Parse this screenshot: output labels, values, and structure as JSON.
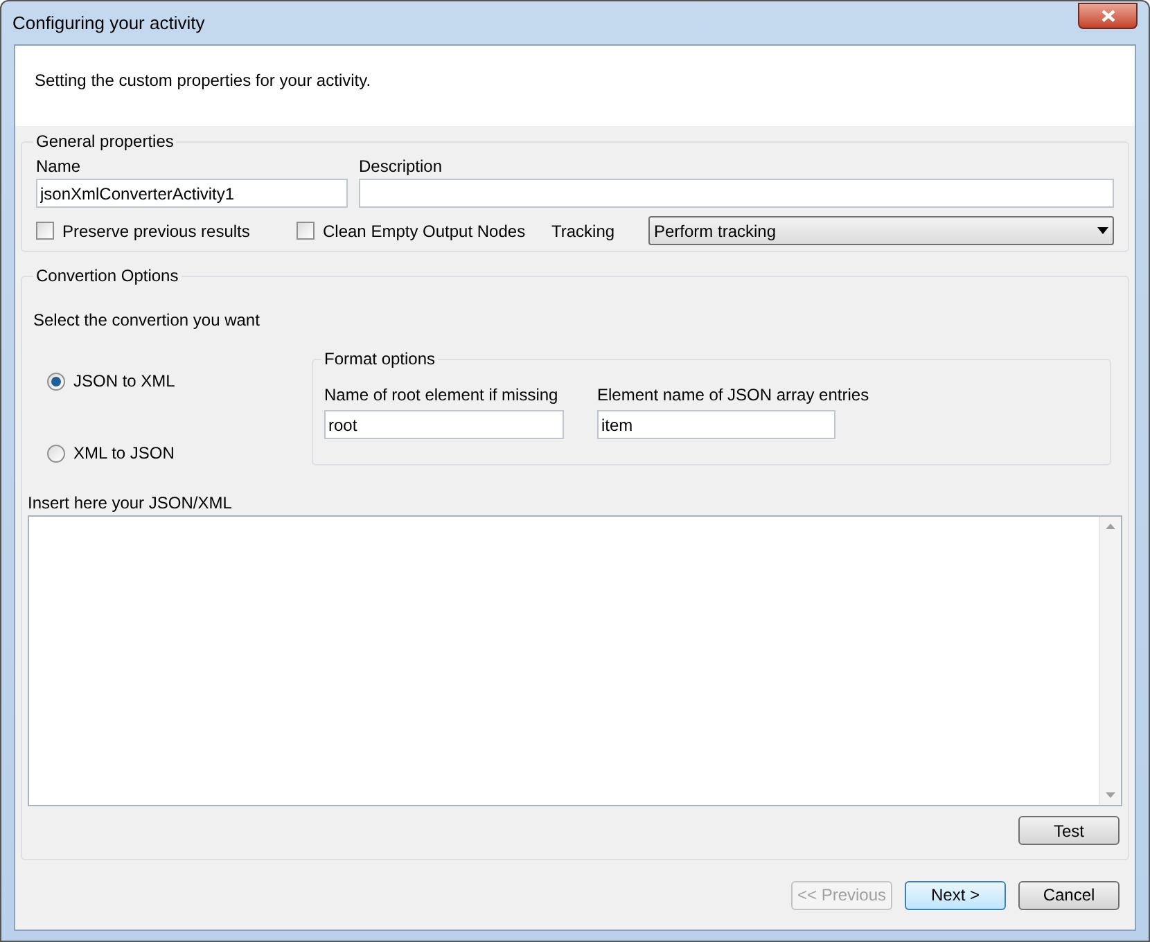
{
  "window": {
    "title": "Configuring your activity"
  },
  "header": {
    "text": "Setting the custom properties for your activity."
  },
  "general": {
    "title": "General properties",
    "name": {
      "label": "Name",
      "value": "jsonXmlConverterActivity1"
    },
    "description": {
      "label": "Description"
    },
    "checkboxes": [
      {
        "label": "Preserve previous results",
        "checked": false
      },
      {
        "label": "Clean Empty Output Nodes",
        "checked": false
      }
    ],
    "tracking": {
      "label": "Tracking",
      "value": "Perform tracking"
    }
  },
  "conversion": {
    "title": "Convertion Options",
    "prompt": "Select the convertion you want",
    "options": [
      {
        "label": "JSON to XML",
        "selected": true
      },
      {
        "label": "XML to JSON",
        "selected": false
      }
    ],
    "format": {
      "title": "Format options",
      "fields": [
        {
          "label": "Name of root element if missing",
          "value": "root"
        },
        {
          "label": "Element name of JSON array entries",
          "value": "item"
        }
      ]
    },
    "input": {
      "label": "Insert here your JSON/XML"
    },
    "test_button": "Test"
  },
  "buttons": [
    {
      "label": "<< Previous",
      "disabled": true,
      "default": false
    },
    {
      "label": "Next >",
      "disabled": false,
      "default": true
    },
    {
      "label": "Cancel",
      "disabled": false,
      "default": false
    }
  ]
}
